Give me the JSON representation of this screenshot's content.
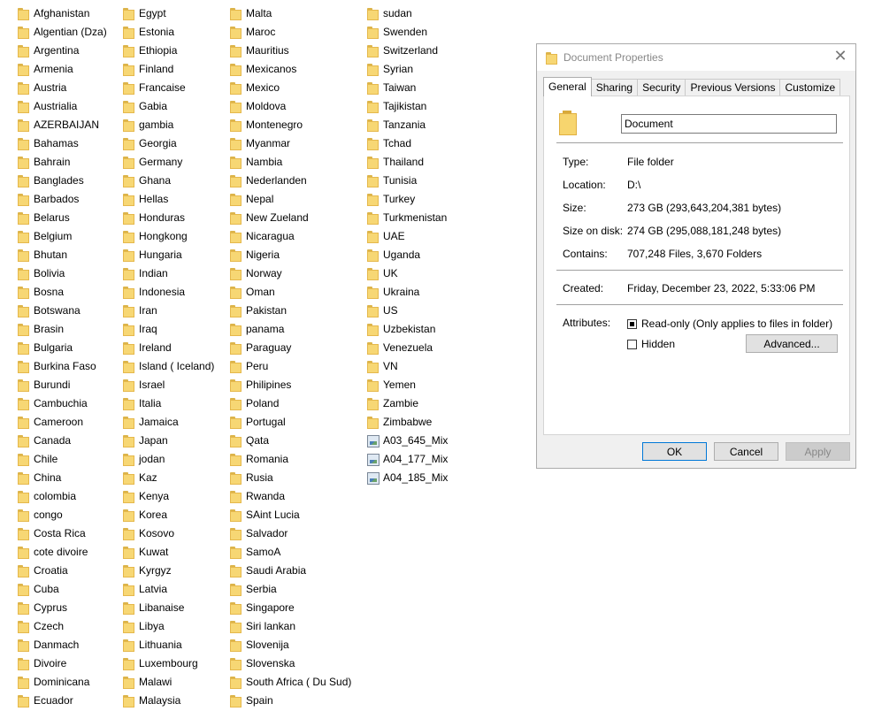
{
  "file_list": {
    "columns": [
      [
        {
          "name": "Afghanistan",
          "type": "folder"
        },
        {
          "name": "Algentian (Dza)",
          "type": "folder"
        },
        {
          "name": "Argentina",
          "type": "folder"
        },
        {
          "name": "Armenia",
          "type": "folder"
        },
        {
          "name": "Austria",
          "type": "folder"
        },
        {
          "name": "Austrialia",
          "type": "folder"
        },
        {
          "name": "AZERBAIJAN",
          "type": "folder"
        },
        {
          "name": "Bahamas",
          "type": "folder"
        },
        {
          "name": "Bahrain",
          "type": "folder"
        },
        {
          "name": "Banglades",
          "type": "folder"
        },
        {
          "name": "Barbados",
          "type": "folder"
        },
        {
          "name": "Belarus",
          "type": "folder"
        },
        {
          "name": "Belgium",
          "type": "folder"
        },
        {
          "name": "Bhutan",
          "type": "folder"
        },
        {
          "name": "Bolivia",
          "type": "folder"
        },
        {
          "name": "Bosna",
          "type": "folder"
        },
        {
          "name": "Botswana",
          "type": "folder"
        },
        {
          "name": "Brasin",
          "type": "folder"
        },
        {
          "name": "Bulgaria",
          "type": "folder"
        },
        {
          "name": "Burkina Faso",
          "type": "folder"
        },
        {
          "name": "Burundi",
          "type": "folder"
        },
        {
          "name": "Cambuchia",
          "type": "folder"
        },
        {
          "name": "Cameroon",
          "type": "folder"
        },
        {
          "name": "Canada",
          "type": "folder"
        },
        {
          "name": "Chile",
          "type": "folder"
        },
        {
          "name": "China",
          "type": "folder"
        },
        {
          "name": "colombia",
          "type": "folder"
        },
        {
          "name": "congo",
          "type": "folder"
        },
        {
          "name": "Costa Rica",
          "type": "folder"
        },
        {
          "name": "cote divoire",
          "type": "folder"
        },
        {
          "name": "Croatia",
          "type": "folder"
        },
        {
          "name": "Cuba",
          "type": "folder"
        },
        {
          "name": "Cyprus",
          "type": "folder"
        },
        {
          "name": "Czech",
          "type": "folder"
        },
        {
          "name": "Danmach",
          "type": "folder"
        },
        {
          "name": "Divoire",
          "type": "folder"
        },
        {
          "name": "Dominicana",
          "type": "folder"
        },
        {
          "name": "Ecuador",
          "type": "folder"
        }
      ],
      [
        {
          "name": "Egypt",
          "type": "folder"
        },
        {
          "name": "Estonia",
          "type": "folder"
        },
        {
          "name": "Ethiopia",
          "type": "folder"
        },
        {
          "name": "Finland",
          "type": "folder"
        },
        {
          "name": "Francaise",
          "type": "folder"
        },
        {
          "name": "Gabia",
          "type": "folder"
        },
        {
          "name": "gambia",
          "type": "folder"
        },
        {
          "name": "Georgia",
          "type": "folder"
        },
        {
          "name": "Germany",
          "type": "folder"
        },
        {
          "name": "Ghana",
          "type": "folder"
        },
        {
          "name": "Hellas",
          "type": "folder"
        },
        {
          "name": "Honduras",
          "type": "folder"
        },
        {
          "name": "Hongkong",
          "type": "folder"
        },
        {
          "name": "Hungaria",
          "type": "folder"
        },
        {
          "name": "Indian",
          "type": "folder"
        },
        {
          "name": "Indonesia",
          "type": "folder"
        },
        {
          "name": "Iran",
          "type": "folder"
        },
        {
          "name": "Iraq",
          "type": "folder"
        },
        {
          "name": "Ireland",
          "type": "folder"
        },
        {
          "name": "Island ( Iceland)",
          "type": "folder"
        },
        {
          "name": "Israel",
          "type": "folder"
        },
        {
          "name": "Italia",
          "type": "folder"
        },
        {
          "name": "Jamaica",
          "type": "folder"
        },
        {
          "name": "Japan",
          "type": "folder"
        },
        {
          "name": "jodan",
          "type": "folder"
        },
        {
          "name": "Kaz",
          "type": "folder"
        },
        {
          "name": "Kenya",
          "type": "folder"
        },
        {
          "name": "Korea",
          "type": "folder"
        },
        {
          "name": "Kosovo",
          "type": "folder"
        },
        {
          "name": "Kuwat",
          "type": "folder"
        },
        {
          "name": "Kyrgyz",
          "type": "folder"
        },
        {
          "name": "Latvia",
          "type": "folder"
        },
        {
          "name": "Libanaise",
          "type": "folder"
        },
        {
          "name": "Libya",
          "type": "folder"
        },
        {
          "name": "Lithuania",
          "type": "folder"
        },
        {
          "name": "Luxembourg",
          "type": "folder"
        },
        {
          "name": "Malawi",
          "type": "folder"
        },
        {
          "name": "Malaysia",
          "type": "folder"
        }
      ],
      [
        {
          "name": "Malta",
          "type": "folder"
        },
        {
          "name": "Maroc",
          "type": "folder"
        },
        {
          "name": "Mauritius",
          "type": "folder"
        },
        {
          "name": "Mexicanos",
          "type": "folder"
        },
        {
          "name": "Mexico",
          "type": "folder"
        },
        {
          "name": "Moldova",
          "type": "folder"
        },
        {
          "name": "Montenegro",
          "type": "folder"
        },
        {
          "name": "Myanmar",
          "type": "folder"
        },
        {
          "name": "Nambia",
          "type": "folder"
        },
        {
          "name": "Nederlanden",
          "type": "folder"
        },
        {
          "name": "Nepal",
          "type": "folder"
        },
        {
          "name": "New Zueland",
          "type": "folder"
        },
        {
          "name": "Nicaragua",
          "type": "folder"
        },
        {
          "name": "Nigeria",
          "type": "folder"
        },
        {
          "name": "Norway",
          "type": "folder"
        },
        {
          "name": "Oman",
          "type": "folder"
        },
        {
          "name": "Pakistan",
          "type": "folder"
        },
        {
          "name": "panama",
          "type": "folder"
        },
        {
          "name": "Paraguay",
          "type": "folder"
        },
        {
          "name": "Peru",
          "type": "folder"
        },
        {
          "name": "Philipines",
          "type": "folder"
        },
        {
          "name": "Poland",
          "type": "folder"
        },
        {
          "name": "Portugal",
          "type": "folder"
        },
        {
          "name": "Qata",
          "type": "folder"
        },
        {
          "name": "Romania",
          "type": "folder"
        },
        {
          "name": "Rusia",
          "type": "folder"
        },
        {
          "name": "Rwanda",
          "type": "folder"
        },
        {
          "name": "SAint Lucia",
          "type": "folder"
        },
        {
          "name": "Salvador",
          "type": "folder"
        },
        {
          "name": "SamoA",
          "type": "folder"
        },
        {
          "name": "Saudi Arabia",
          "type": "folder"
        },
        {
          "name": "Serbia",
          "type": "folder"
        },
        {
          "name": "Singapore",
          "type": "folder"
        },
        {
          "name": "Siri lankan",
          "type": "folder"
        },
        {
          "name": "Slovenija",
          "type": "folder"
        },
        {
          "name": "Slovenska",
          "type": "folder"
        },
        {
          "name": "South Africa ( Du Sud)",
          "type": "folder"
        },
        {
          "name": "Spain",
          "type": "folder"
        }
      ],
      [
        {
          "name": "sudan",
          "type": "folder"
        },
        {
          "name": "Swenden",
          "type": "folder"
        },
        {
          "name": "Switzerland",
          "type": "folder"
        },
        {
          "name": "Syrian",
          "type": "folder"
        },
        {
          "name": "Taiwan",
          "type": "folder"
        },
        {
          "name": "Tajikistan",
          "type": "folder"
        },
        {
          "name": "Tanzania",
          "type": "folder"
        },
        {
          "name": "Tchad",
          "type": "folder"
        },
        {
          "name": "Thailand",
          "type": "folder"
        },
        {
          "name": "Tunisia",
          "type": "folder"
        },
        {
          "name": "Turkey",
          "type": "folder"
        },
        {
          "name": "Turkmenistan",
          "type": "folder"
        },
        {
          "name": "UAE",
          "type": "folder"
        },
        {
          "name": "Uganda",
          "type": "folder"
        },
        {
          "name": "UK",
          "type": "folder"
        },
        {
          "name": "Ukraina",
          "type": "folder"
        },
        {
          "name": "US",
          "type": "folder"
        },
        {
          "name": "Uzbekistan",
          "type": "folder"
        },
        {
          "name": "Venezuela",
          "type": "folder"
        },
        {
          "name": "VN",
          "type": "folder"
        },
        {
          "name": "Yemen",
          "type": "folder"
        },
        {
          "name": "Zambie",
          "type": "folder"
        },
        {
          "name": "Zimbabwe",
          "type": "folder"
        },
        {
          "name": "A03_645_Mix",
          "type": "image"
        },
        {
          "name": "A04_177_Mix",
          "type": "image"
        },
        {
          "name": "A04_185_Mix",
          "type": "image"
        }
      ]
    ]
  },
  "dialog": {
    "title": "Document Properties",
    "close_glyph": "✕",
    "tabs": [
      {
        "label": "General",
        "active": true
      },
      {
        "label": "Sharing",
        "active": false
      },
      {
        "label": "Security",
        "active": false
      },
      {
        "label": "Previous Versions",
        "active": false
      },
      {
        "label": "Customize",
        "active": false
      }
    ],
    "name_value": "Document",
    "type_label": "Type:",
    "type_value": "File folder",
    "location_label": "Location:",
    "location_value": "D:\\",
    "size_label": "Size:",
    "size_value": "273 GB (293,643,204,381 bytes)",
    "size_on_disk_label": "Size on disk:",
    "size_on_disk_value": "274 GB (295,088,181,248 bytes)",
    "contains_label": "Contains:",
    "contains_value": "707,248 Files, 3,670 Folders",
    "created_label": "Created:",
    "created_value": "Friday, December 23, 2022, 5:33:06 PM",
    "attributes_label": "Attributes:",
    "readonly_label": "Read-only (Only applies to files in folder)",
    "readonly_state": "indeterminate",
    "hidden_label": "Hidden",
    "hidden_state": "unchecked",
    "advanced_button": "Advanced...",
    "ok_button": "OK",
    "cancel_button": "Cancel",
    "apply_button": "Apply"
  },
  "colors": {
    "folder_yellow": "#f7d774",
    "dialog_bg": "#f0f0f0",
    "button_bg": "#e1e1e1"
  }
}
